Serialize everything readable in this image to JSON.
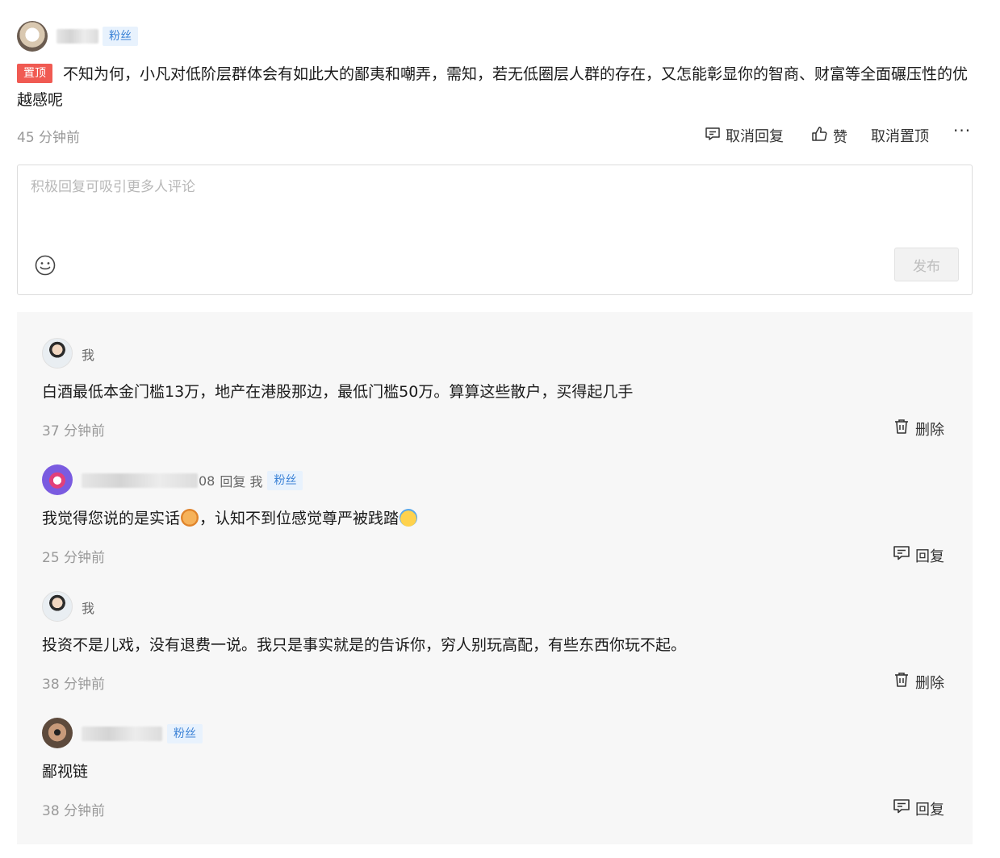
{
  "comment": {
    "badge": "粉丝",
    "pin_label": "置顶",
    "text": "不知为何，小凡对低阶层群体会有如此大的鄙夷和嘲弄，需知，若无低圈层人群的存在，又怎能彰显你的智商、财富等全面碾压性的优越感呢",
    "time": "45 分钟前",
    "actions": {
      "reply": "取消回复",
      "like": "赞",
      "unpin": "取消置顶",
      "more": "···"
    }
  },
  "editor": {
    "placeholder": "积极回复可吸引更多人评论",
    "publish": "发布"
  },
  "replies": [
    {
      "author": "我",
      "text": "白酒最低本金门槛13万，地产在港股那边，最低门槛50万。算算这些散户，买得起几手",
      "time": "37 分钟前",
      "action": "删除",
      "action_icon": "trash-icon"
    },
    {
      "author_suffix": "08",
      "reply_to": "回复 我",
      "badge": "粉丝",
      "text_a": "我觉得您说的是实话",
      "text_b": "，认知不到位感觉尊严被践踏",
      "time": "25 分钟前",
      "action": "回复",
      "action_icon": "reply-icon"
    },
    {
      "author": "我",
      "text": "投资不是儿戏，没有退费一说。我只是事实就是的告诉你，穷人别玩高配，有些东西你玩不起。",
      "time": "38 分钟前",
      "action": "删除",
      "action_icon": "trash-icon"
    },
    {
      "badge": "粉丝",
      "text": "鄙视链",
      "time": "38 分钟前",
      "action": "回复",
      "action_icon": "reply-icon"
    }
  ],
  "colors": {
    "pin_badge": "#f05a52",
    "fan_badge_bg": "#e8f2fd",
    "fan_badge_text": "#3b82d6",
    "panel_bg": "#f7f7f7"
  }
}
